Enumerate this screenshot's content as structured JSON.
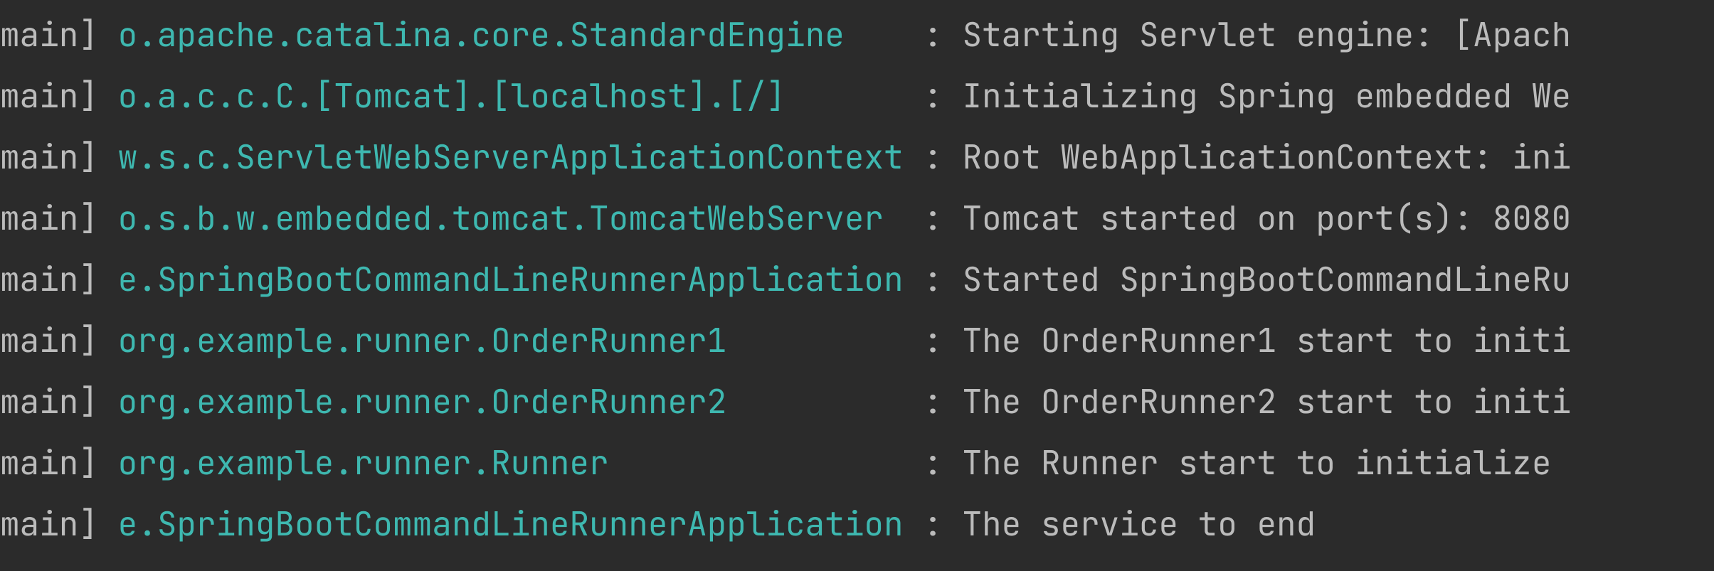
{
  "log_lines": [
    {
      "thread": "main]",
      "logger": "o.apache.catalina.core.StandardEngine   ",
      "sep": ": ",
      "message": "Starting Servlet engine: [Apach"
    },
    {
      "thread": "main]",
      "logger": "o.a.c.c.C.[Tomcat].[localhost].[/]      ",
      "sep": ": ",
      "message": "Initializing Spring embedded We"
    },
    {
      "thread": "main]",
      "logger": "w.s.c.ServletWebServerApplicationContext",
      "sep": ": ",
      "message": "Root WebApplicationContext: ini"
    },
    {
      "thread": "main]",
      "logger": "o.s.b.w.embedded.tomcat.TomcatWebServer ",
      "sep": ": ",
      "message": "Tomcat started on port(s): 8080"
    },
    {
      "thread": "main]",
      "logger": "e.SpringBootCommandLineRunnerApplication",
      "sep": ": ",
      "message": "Started SpringBootCommandLineRu"
    },
    {
      "thread": "main]",
      "logger": "org.example.runner.OrderRunner1         ",
      "sep": ": ",
      "message": "The OrderRunner1 start to initi"
    },
    {
      "thread": "main]",
      "logger": "org.example.runner.OrderRunner2         ",
      "sep": ": ",
      "message": "The OrderRunner2 start to initi"
    },
    {
      "thread": "main]",
      "logger": "org.example.runner.Runner               ",
      "sep": ": ",
      "message": "The Runner start to initialize "
    },
    {
      "thread": "main]",
      "logger": "e.SpringBootCommandLineRunnerApplication",
      "sep": ": ",
      "message": "The service to end"
    }
  ]
}
